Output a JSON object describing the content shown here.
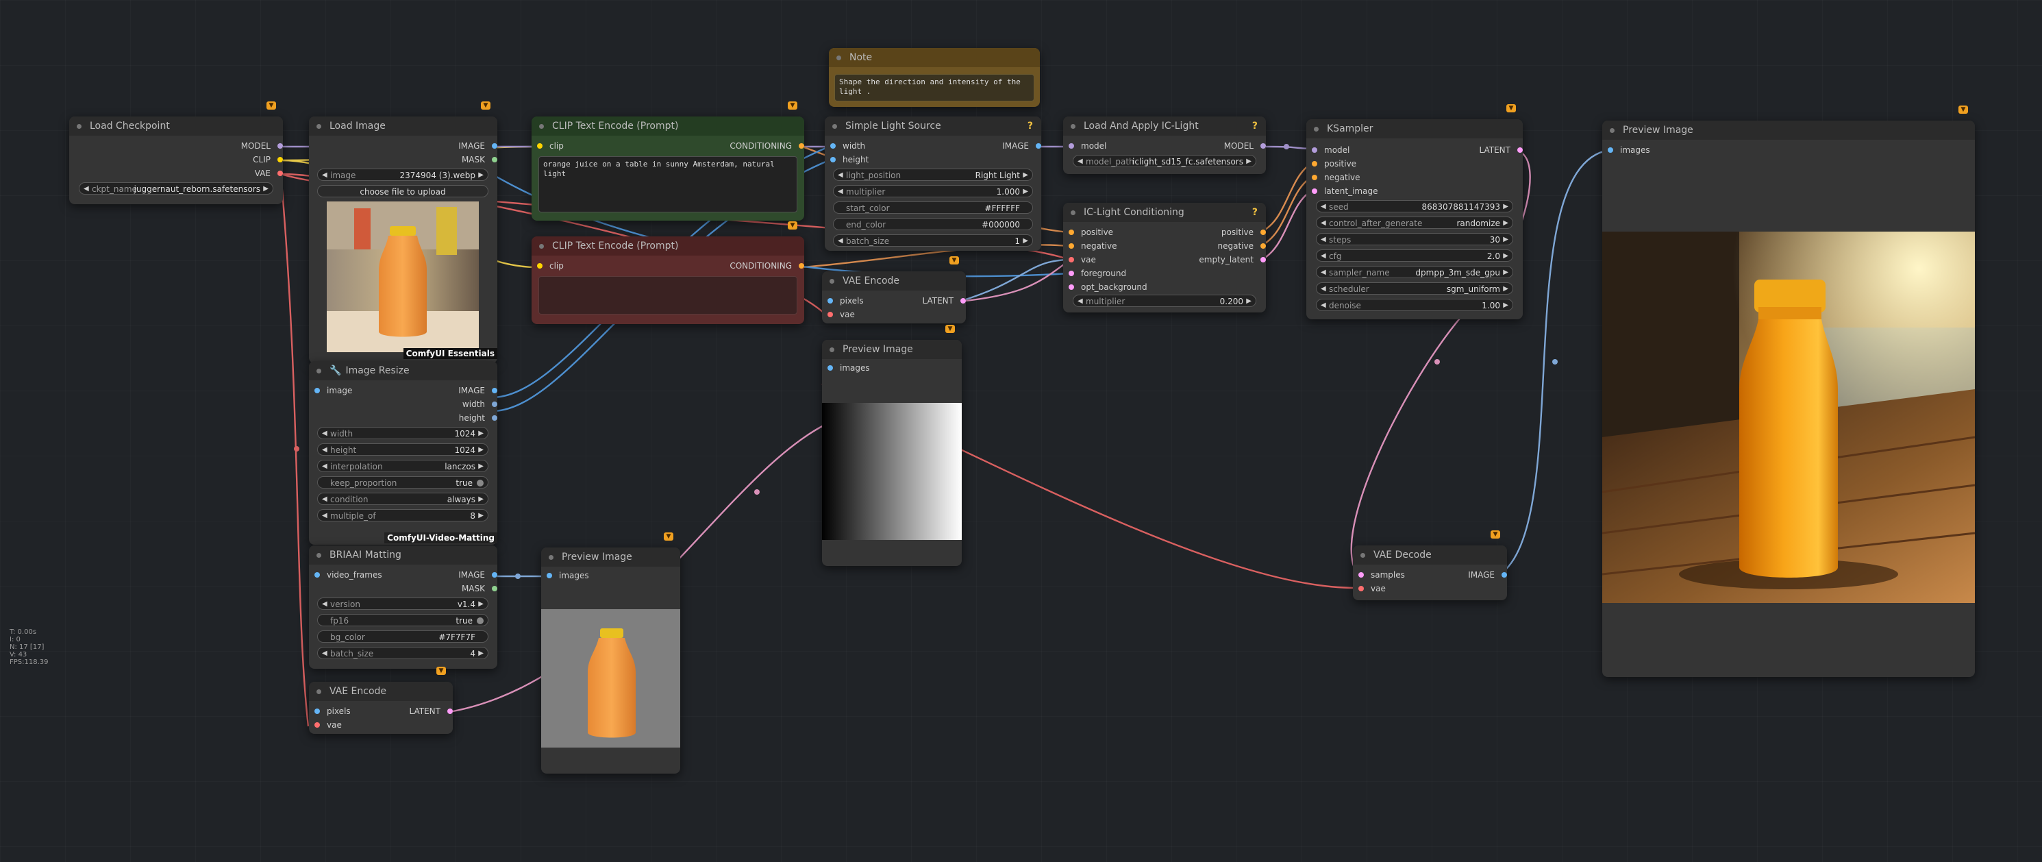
{
  "stats": [
    "T: 0.00s",
    "I: 0",
    "N: 17 [17]",
    "V: 43",
    "FPS:118.39"
  ],
  "nodes": {
    "load_checkpoint": {
      "title": "Load Checkpoint",
      "outputs": [
        "MODEL",
        "CLIP",
        "VAE"
      ],
      "ckpt_label": "ckpt_name",
      "ckpt_value": "juggernaut_reborn.safetensors"
    },
    "load_image": {
      "title": "Load Image",
      "outputs": [
        "IMAGE",
        "MASK"
      ],
      "image_label": "image",
      "image_value": "2374904 (3).webp",
      "upload_label": "choose file to upload"
    },
    "essentials_tag": "ComfyUI Essentials",
    "clip_pos": {
      "title": "CLIP Text Encode (Prompt)",
      "input": "clip",
      "output": "CONDITIONING",
      "text": "orange juice on a table in sunny Amsterdam, natural light"
    },
    "clip_neg": {
      "title": "CLIP Text Encode (Prompt)",
      "input": "clip",
      "output": "CONDITIONING",
      "text": ""
    },
    "note": {
      "title": "Note",
      "text": "Shape the direction and intensity of the light ."
    },
    "simple_light": {
      "title": "Simple Light Source",
      "inputs": [
        "width",
        "height"
      ],
      "output": "IMAGE",
      "widgets": [
        {
          "label": "light_position",
          "value": "Right Light"
        },
        {
          "label": "multiplier",
          "value": "1.000"
        },
        {
          "label": "start_color",
          "value": "#FFFFFF"
        },
        {
          "label": "end_color",
          "value": "#000000"
        },
        {
          "label": "batch_size",
          "value": "1"
        }
      ]
    },
    "vae_encode_1": {
      "title": "VAE Encode",
      "inputs": [
        "pixels",
        "vae"
      ],
      "output": "LATENT"
    },
    "preview_gradient": {
      "title": "Preview Image",
      "input": "images"
    },
    "load_iclight": {
      "title": "Load And Apply IC-Light",
      "input": "model",
      "output": "MODEL",
      "path_label": "model_path",
      "path_value": "iclight_sd15_fc.safetensors"
    },
    "iclight_cond": {
      "title": "IC-Light Conditioning",
      "inputs": [
        "positive",
        "negative",
        "vae",
        "foreground",
        "opt_background"
      ],
      "outputs": [
        "positive",
        "negative",
        "empty_latent"
      ],
      "mult_label": "multiplier",
      "mult_value": "0.200"
    },
    "ksampler": {
      "title": "KSampler",
      "inputs": [
        "model",
        "positive",
        "negative",
        "latent_image"
      ],
      "output": "LATENT",
      "widgets": [
        {
          "label": "seed",
          "value": "868307881147393"
        },
        {
          "label": "control_after_generate",
          "value": "randomize"
        },
        {
          "label": "steps",
          "value": "30"
        },
        {
          "label": "cfg",
          "value": "2.0"
        },
        {
          "label": "sampler_name",
          "value": "dpmpp_3m_sde_gpu"
        },
        {
          "label": "scheduler",
          "value": "sgm_uniform"
        },
        {
          "label": "denoise",
          "value": "1.00"
        }
      ]
    },
    "preview_final": {
      "title": "Preview Image",
      "input": "images"
    },
    "image_resize": {
      "title": "Image Resize",
      "input": "image",
      "outputs": [
        "IMAGE",
        "width",
        "height"
      ],
      "widgets": [
        {
          "label": "width",
          "value": "1024"
        },
        {
          "label": "height",
          "value": "1024"
        },
        {
          "label": "interpolation",
          "value": "lanczos"
        },
        {
          "label": "keep_proportion",
          "value": "true"
        },
        {
          "label": "condition",
          "value": "always"
        },
        {
          "label": "multiple_of",
          "value": "8"
        }
      ]
    },
    "video_matting_tag": "ComfyUI-Video-Matting",
    "briaai": {
      "title": "BRIAAI Matting",
      "input": "video_frames",
      "outputs": [
        "IMAGE",
        "MASK"
      ],
      "widgets": [
        {
          "label": "version",
          "value": "v1.4"
        },
        {
          "label": "fp16",
          "value": "true"
        },
        {
          "label": "bg_color",
          "value": "#7F7F7F"
        },
        {
          "label": "batch_size",
          "value": "4"
        }
      ]
    },
    "vae_encode_2": {
      "title": "VAE Encode",
      "inputs": [
        "pixels",
        "vae"
      ],
      "output": "LATENT"
    },
    "preview_matte": {
      "title": "Preview Image",
      "input": "images"
    },
    "vae_decode": {
      "title": "VAE Decode",
      "inputs": [
        "samples",
        "vae"
      ],
      "output": "IMAGE"
    }
  },
  "colors": {
    "canvas": "#202327",
    "node": "#353535",
    "clip_link": "#ffd500",
    "model_link": "#b39ddb",
    "vae_link": "#ff6e6e",
    "image_link": "#64b5f6",
    "latent_link": "#ff9cf9",
    "cond_link": "#ffa931"
  }
}
